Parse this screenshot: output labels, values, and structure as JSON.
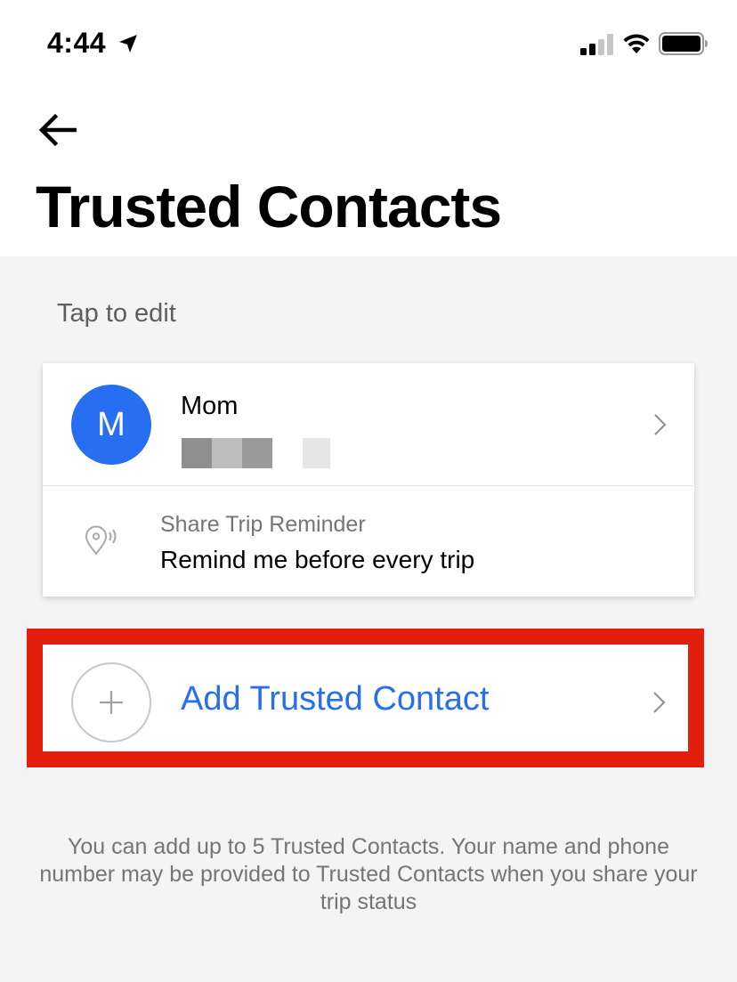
{
  "status_bar": {
    "time": "4:44",
    "location_icon": "location-arrow-icon",
    "signal_icon": "cellular-signal-icon",
    "wifi_icon": "wifi-icon",
    "battery_icon": "battery-icon"
  },
  "header": {
    "back_icon": "back-arrow-icon",
    "title": "Trusted Contacts"
  },
  "hint": "Tap to edit",
  "contact": {
    "initial": "M",
    "name": "Mom",
    "avatar_color": "#276ef1",
    "chevron_icon": "chevron-right-icon"
  },
  "reminder": {
    "icon": "location-pin-broadcast-icon",
    "label": "Share Trip Reminder",
    "value": "Remind me before every trip"
  },
  "add_contact": {
    "icon": "plus-icon",
    "label": "Add Trusted Contact",
    "chevron_icon": "chevron-right-icon",
    "highlight_color": "#e11f0c"
  },
  "footnote": "You can add up to 5 Trusted Contacts. Your name and phone number may be provided to Trusted Contacts when you share your trip status"
}
